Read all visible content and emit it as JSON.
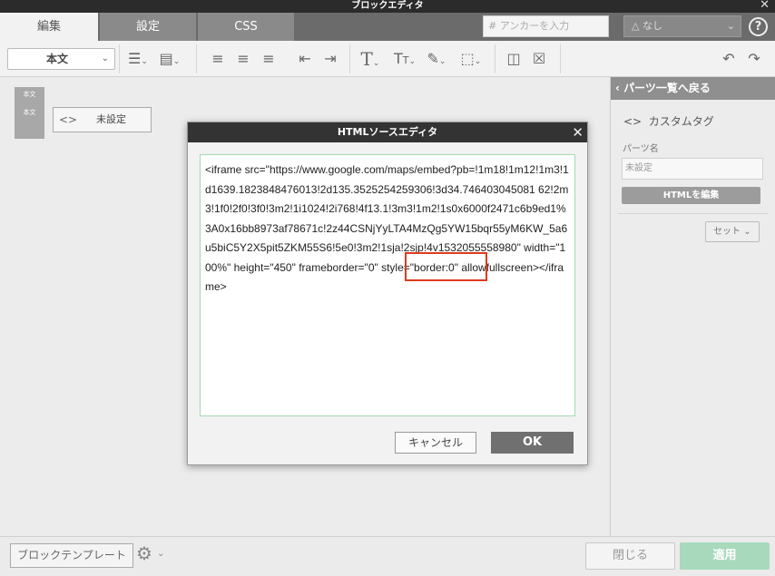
{
  "window": {
    "title": "ブロックエディタ",
    "close_glyph": "✕"
  },
  "tabs": [
    {
      "label": "編集",
      "active": true
    },
    {
      "label": "設定",
      "active": false
    },
    {
      "label": "CSS",
      "active": false
    }
  ],
  "anchor": {
    "placeholder": "# アンカーを入力"
  },
  "color_select": {
    "value": "なし"
  },
  "help_glyph": "?",
  "toolbar": {
    "style_select": "本文",
    "icons": [
      "list-icon",
      "align-block-icon",
      "align-left-icon",
      "align-center-icon",
      "align-right-icon",
      "outdent-icon",
      "indent-icon",
      "text-icon",
      "font-size-icon",
      "eyedropper-icon",
      "border-icon",
      "column-icon",
      "clear-format-icon",
      "undo-icon",
      "redo-icon"
    ]
  },
  "canvas": {
    "block_tags": [
      "本文",
      "本文"
    ],
    "block_item": {
      "icon": "<>",
      "label": "未設定"
    }
  },
  "right_panel": {
    "back_label": "パーツ一覧へ戻る",
    "custom_tag_icon": "<>",
    "custom_tag_label": "カスタムタグ",
    "parts_name_label": "パーツ名",
    "parts_name_placeholder": "未設定",
    "html_edit_button": "HTMLを編集",
    "set_button": "セット"
  },
  "bottom": {
    "template_button": "ブロックテンプレート",
    "close_button": "閉じる",
    "apply_button": "適用"
  },
  "modal": {
    "title": "HTMLソースエディタ",
    "close_glyph": "✕",
    "code": "<iframe src=\"https://www.google.com/maps/embed?pb=!1m18!1m12!1m3!1d1639.1823848476013!2d135.3525254259306!3d34.746403045081 62!2m3!1f0!2f0!3f0!3m2!1i1024!2i768!4f13.1!3m3!1m2!1s0x6000f2471c6b9ed1%3A0x16bb8973af78671c!2z44CSNjYyLTA4MzQg5YW15bqr55yM6KW_5a6u5biC5Y2X5pit5ZKM55S6!5e0!3m2!1sja!2sjp!4v1532055558980\" width=\"100%\" height=\"450\" frameborder=\"0\" style=\"border:0\" allowfullscreen></iframe>",
    "cancel_button": "キャンセル",
    "ok_button": "OK"
  },
  "colors": {
    "highlight": "#e03a1e",
    "apply": "#a8d9bd",
    "code_border": "#a6d9b3"
  }
}
